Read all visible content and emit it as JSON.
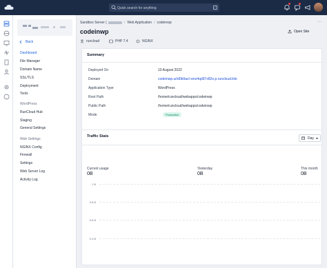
{
  "topbar": {
    "search_placeholder": "Quick search for anything",
    "search_shortcut": "/"
  },
  "breadcrumb": {
    "server": "Sandbox Server (",
    "section": "Web Application",
    "app": "codeinwp",
    "more": "..."
  },
  "sidebar": {
    "back_label": "Back",
    "main_items": [
      "Dashboard",
      "File Manager",
      "Domain Name",
      "SSL/TLS",
      "Deployment",
      "Tools"
    ],
    "wordpress_heading": "WordPress",
    "wordpress_items": [
      "RunCloud Hub",
      "Staging",
      "General Settings"
    ],
    "webapp_heading": "Web Settings",
    "webapp_items": [
      "NGINX Config",
      "Firewall",
      "Settings",
      "Web Server Log",
      "Activity Log"
    ]
  },
  "header": {
    "title": "codeinwp",
    "open_site_label": "Open Site",
    "user": "runcloud",
    "php": "PHP 7.4",
    "server_type": "NGINX"
  },
  "summary": {
    "title": "Summary",
    "rows": [
      {
        "label": "Deployed On",
        "value": "10 August 2022"
      },
      {
        "label": "Domain",
        "value": "codeinwp.urld0b9acl-xmz4qd97x82o.p.runcloud.link"
      },
      {
        "label": "Application Type",
        "value": "WordPress"
      },
      {
        "label": "Root Path",
        "value": "/home/runcloud/webapps/codeinwp"
      },
      {
        "label": "Public Path",
        "value": "/home/runcloud/webapps/codeinwp"
      },
      {
        "label": "Mode",
        "value": "Production"
      }
    ]
  },
  "traffic": {
    "title": "Traffic Stats",
    "range_label": "Day",
    "stats": [
      {
        "label": "Current usage",
        "value": "0B"
      },
      {
        "label": "Yesterday",
        "value": "0B"
      },
      {
        "label": "This month",
        "value": "0B"
      }
    ],
    "y_ticks": [
      "1 B",
      "0.8 B",
      "0.6 B",
      "0.4 B"
    ]
  },
  "colors": {
    "topbar": "#1c2b45",
    "accent": "#1c64d9",
    "production_badge": "#d7f5ea"
  }
}
